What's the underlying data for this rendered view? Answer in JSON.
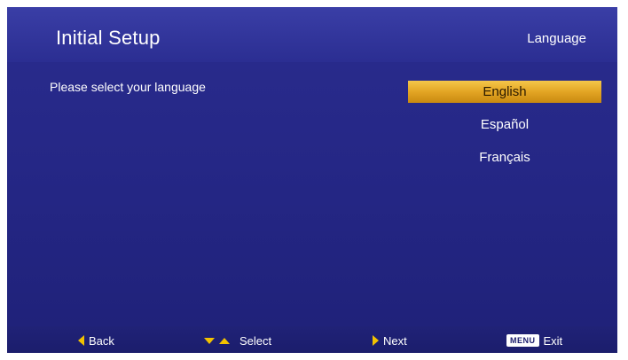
{
  "header": {
    "title": "Initial Setup",
    "section": "Language"
  },
  "prompt": "Please select your language",
  "languages": [
    {
      "label": "English",
      "selected": true
    },
    {
      "label": "Español",
      "selected": false
    },
    {
      "label": "Français",
      "selected": false
    }
  ],
  "footer": {
    "back": "Back",
    "select": "Select",
    "next": "Next",
    "menu_key": "MENU",
    "exit": "Exit"
  },
  "colors": {
    "background": "#2a2c8e",
    "highlight": "#e3a524",
    "arrow": "#f2c200"
  }
}
